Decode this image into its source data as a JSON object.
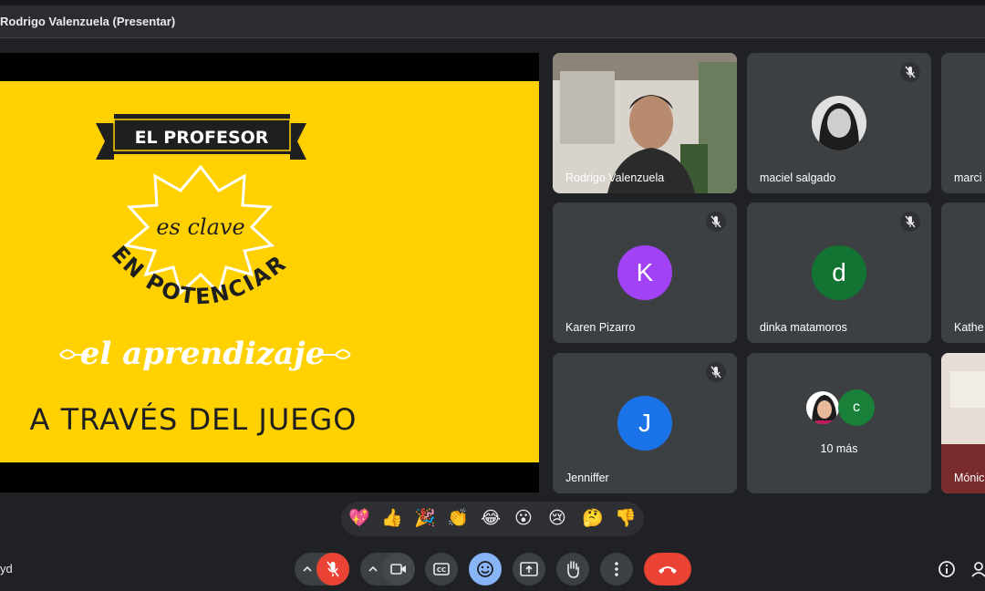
{
  "window": {
    "presenter_title": "Rodrigo Valenzuela (Presentar)"
  },
  "slide": {
    "line1": "EL PROFESOR",
    "line2": "es clave",
    "line3": "EN POTENCIAR",
    "line4": "el aprendizaje",
    "line5": "A TRAVÉS DEL JUEGO"
  },
  "participants": [
    {
      "name": "Rodrigo Valenzuela",
      "type": "video"
    },
    {
      "name": "maciel salgado",
      "type": "photo"
    },
    {
      "name": "marci",
      "type": "partial"
    },
    {
      "name": "Karen Pizarro",
      "initial": "K",
      "color": "#a142f4"
    },
    {
      "name": "dinka matamoros",
      "initial": "d",
      "color": "#137333"
    },
    {
      "name": "Kathe",
      "type": "partial"
    },
    {
      "name": "Jenniffer",
      "initial": "J",
      "color": "#1a73e8"
    },
    {
      "name": "10 más",
      "initial": "C",
      "color": "#188038"
    },
    {
      "name": "Mónic",
      "type": "partial"
    }
  ],
  "reactions": [
    "💖",
    "👍",
    "🎉",
    "👏",
    "😂",
    "😮",
    "😢",
    "🤔",
    "👎"
  ],
  "footer": {
    "left_text": "yd"
  },
  "colors": {
    "end_call": "#ea4335",
    "mic_off": "#ea4335",
    "active": "#8ab4f8",
    "slide_bg": "#ffd100"
  }
}
